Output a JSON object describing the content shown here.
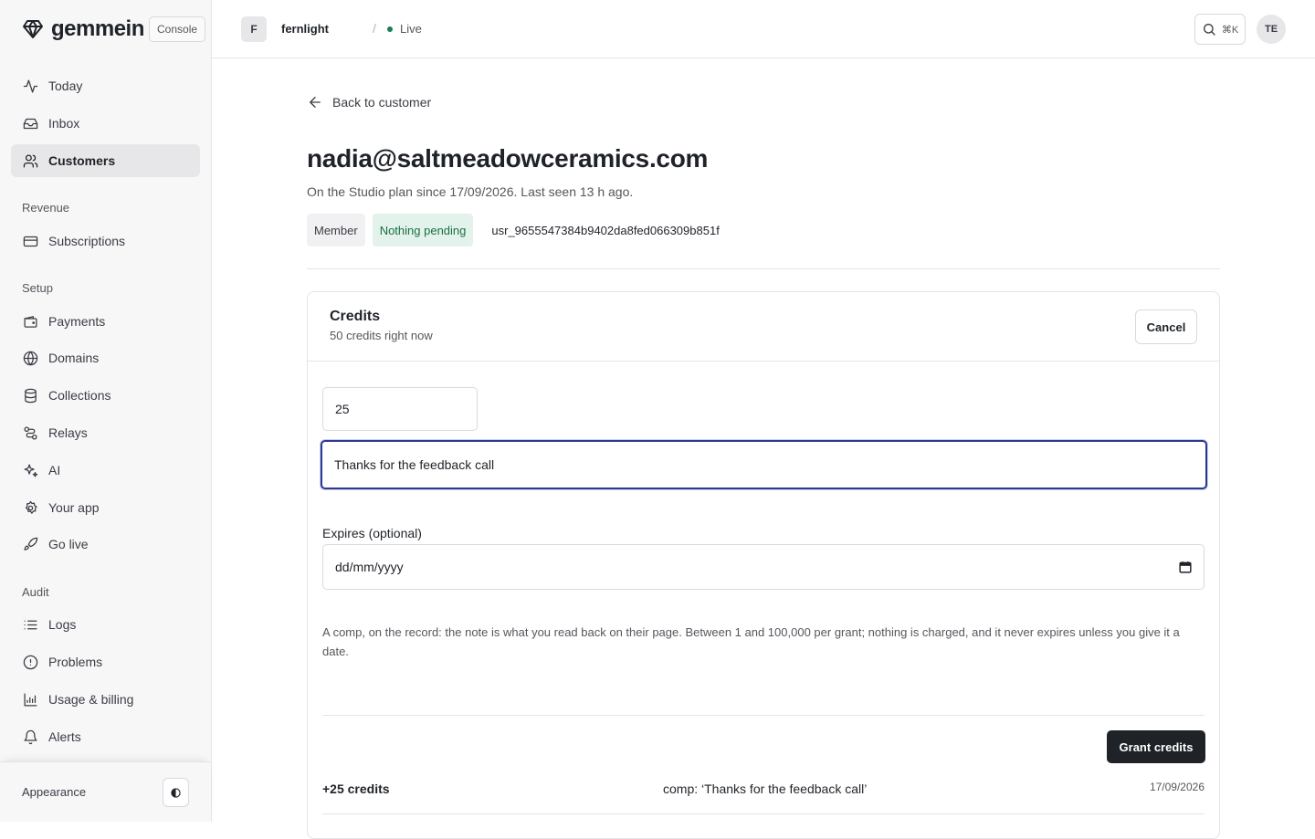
{
  "brand": {
    "name": "gemmein",
    "console_label": "Console",
    "logo_icon": "gem-icon"
  },
  "sidebar": {
    "primary": [
      {
        "label": "Today",
        "icon": "activity-icon"
      },
      {
        "label": "Inbox",
        "icon": "inbox-icon"
      },
      {
        "label": "Customers",
        "icon": "users-icon",
        "active": true
      }
    ],
    "sections": [
      {
        "title": "Revenue",
        "items": [
          {
            "label": "Subscriptions",
            "icon": "credit-card-icon"
          }
        ]
      },
      {
        "title": "Setup",
        "items": [
          {
            "label": "Payments",
            "icon": "wallet-icon"
          },
          {
            "label": "Domains",
            "icon": "globe-icon"
          },
          {
            "label": "Collections",
            "icon": "database-icon"
          },
          {
            "label": "Relays",
            "icon": "route-icon"
          },
          {
            "label": "AI",
            "icon": "sparkles-icon"
          },
          {
            "label": "Your app",
            "icon": "settings-icon"
          },
          {
            "label": "Go live",
            "icon": "rocket-icon"
          }
        ]
      },
      {
        "title": "Audit",
        "items": [
          {
            "label": "Logs",
            "icon": "list-icon"
          },
          {
            "label": "Problems",
            "icon": "alert-circle-icon"
          },
          {
            "label": "Usage & billing",
            "icon": "chart-icon"
          },
          {
            "label": "Alerts",
            "icon": "bell-icon"
          }
        ]
      }
    ],
    "footer": {
      "appearance_label": "Appearance",
      "theme_icon": "contrast-icon"
    }
  },
  "topbar": {
    "org_initial": "F",
    "org_name": "fernlight",
    "separator": "/",
    "environment": "Live",
    "environment_color": "#1a7f52",
    "search_shortcut": "⌘K",
    "user_initials": "TE"
  },
  "main": {
    "back_label": "Back to customer",
    "email": "nadia@saltmeadowceramics.com",
    "subtitle": "On the Studio plan since 17/09/2026. Last seen 13 h ago.",
    "badges": {
      "role": "Member",
      "status": "Nothing pending"
    },
    "user_id": "usr_9655547384b9402da8fed066309b851f"
  },
  "credits": {
    "title": "Credits",
    "balance_text": "50 credits right now",
    "cancel_label": "Cancel",
    "amount_value": "25",
    "note_value": "Thanks for the feedback call",
    "expires_label": "Expires (optional)",
    "date_placeholder": "dd/mm/yyyy",
    "helper_text": "A comp, on the record: the note is what you read back on their page. Between 1 and 100,000 per grant; nothing is charged, and it never expires unless you give it a date.",
    "grant_label": "Grant credits",
    "ledger": [
      {
        "amount": "+25 credits",
        "note": "comp: ‘Thanks for the feedback call’",
        "date": "17/09/2026"
      }
    ]
  }
}
